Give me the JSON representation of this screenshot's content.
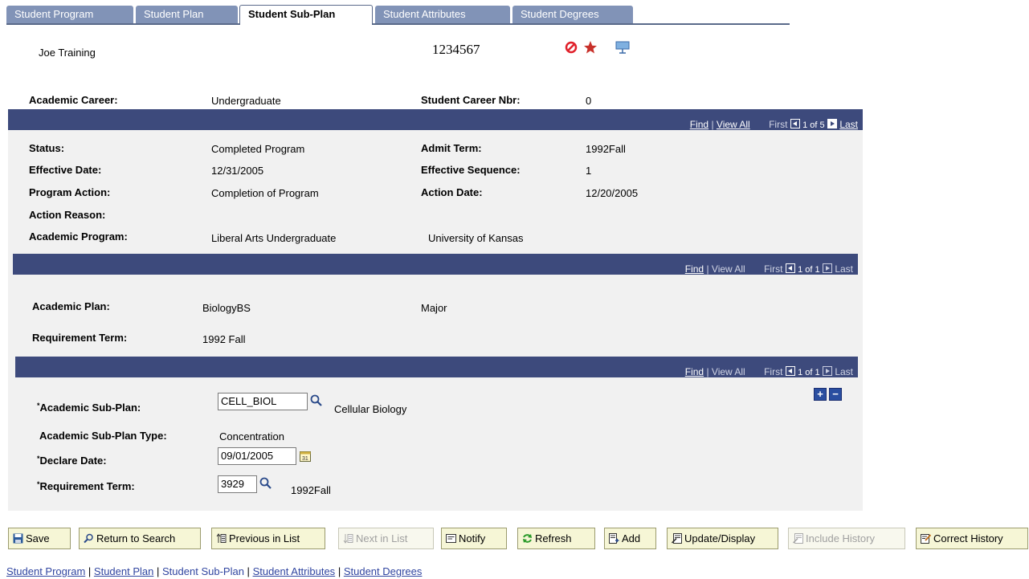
{
  "tabs": [
    {
      "label": "Student Program",
      "active": false
    },
    {
      "label": "Student Plan",
      "active": false
    },
    {
      "label": "Student Sub-Plan",
      "active": true
    },
    {
      "label": "Student Attributes",
      "active": false
    },
    {
      "label": "Student Degrees",
      "active": false
    }
  ],
  "header": {
    "name": "Joe Training",
    "id": "1234567",
    "career_label": "Academic Career:",
    "career_value": "Undergraduate",
    "career_nbr_label": "Student Career Nbr:",
    "career_nbr_value": "0"
  },
  "program_bar": {
    "find": "Find",
    "sep": "|",
    "view_all": "View All",
    "first": "First",
    "count": "1 of 5",
    "last": "Last"
  },
  "program": {
    "status_label": "Status:",
    "status_value": "Completed Program",
    "admit_label": "Admit Term:",
    "admit_value": "1992Fall",
    "eff_date_label": "Effective Date:",
    "eff_date_value": "12/31/2005",
    "eff_seq_label": "Effective Sequence:",
    "eff_seq_value": "1",
    "action_label": "Program Action:",
    "action_value": "Completion of Program",
    "action_date_label": "Action Date:",
    "action_date_value": "12/20/2005",
    "reason_label": "Action Reason:",
    "acad_prog_label": "Academic Program:",
    "acad_prog_value": "Liberal Arts Undergraduate",
    "acad_prog_institution": "University of Kansas"
  },
  "plan_bar": {
    "find": "Find",
    "sep": "|",
    "view_all": "View All",
    "first": "First",
    "count": "1 of 1",
    "last": "Last"
  },
  "plan": {
    "plan_label": "Academic Plan:",
    "plan_value": "BiologyBS",
    "plan_type": "Major",
    "req_term_label": "Requirement Term:",
    "req_term_value": "1992 Fall"
  },
  "subplan_bar": {
    "find": "Find",
    "sep": "|",
    "view_all": "View All",
    "first": "First",
    "count": "1 of 1",
    "last": "Last"
  },
  "subplan": {
    "subplan_label": "Academic Sub-Plan:",
    "subplan_input": "CELL_BIOL",
    "subplan_descr": "Cellular Biology",
    "type_label": "Academic Sub-Plan Type:",
    "type_value": "Concentration",
    "declare_label": "Declare Date:",
    "declare_input": "09/01/2005",
    "req_term_label": "Requirement Term:",
    "req_term_input": "3929",
    "req_term_descr": "1992Fall",
    "required_marker": "*",
    "add_row": "+",
    "delete_row": "−"
  },
  "buttons": {
    "save": "Save",
    "return_search": "Return to Search",
    "prev_list": "Previous in List",
    "next_list": "Next in List",
    "notify": "Notify",
    "refresh": "Refresh",
    "add": "Add",
    "update_display": "Update/Display",
    "include_history": "Include History",
    "correct_history": "Correct History"
  },
  "footer_links": {
    "l1": "Student Program",
    "l2": "Student Plan",
    "l3": "Student Sub-Plan",
    "l4": "Student Attributes",
    "l5": "Student Degrees",
    "sep": "|"
  },
  "colors": {
    "bar": "#3d4a7c",
    "tab": "#8193b7",
    "panel": "#f1f1f1",
    "button_bg": "#f6f6d6",
    "link": "#3045a0"
  }
}
